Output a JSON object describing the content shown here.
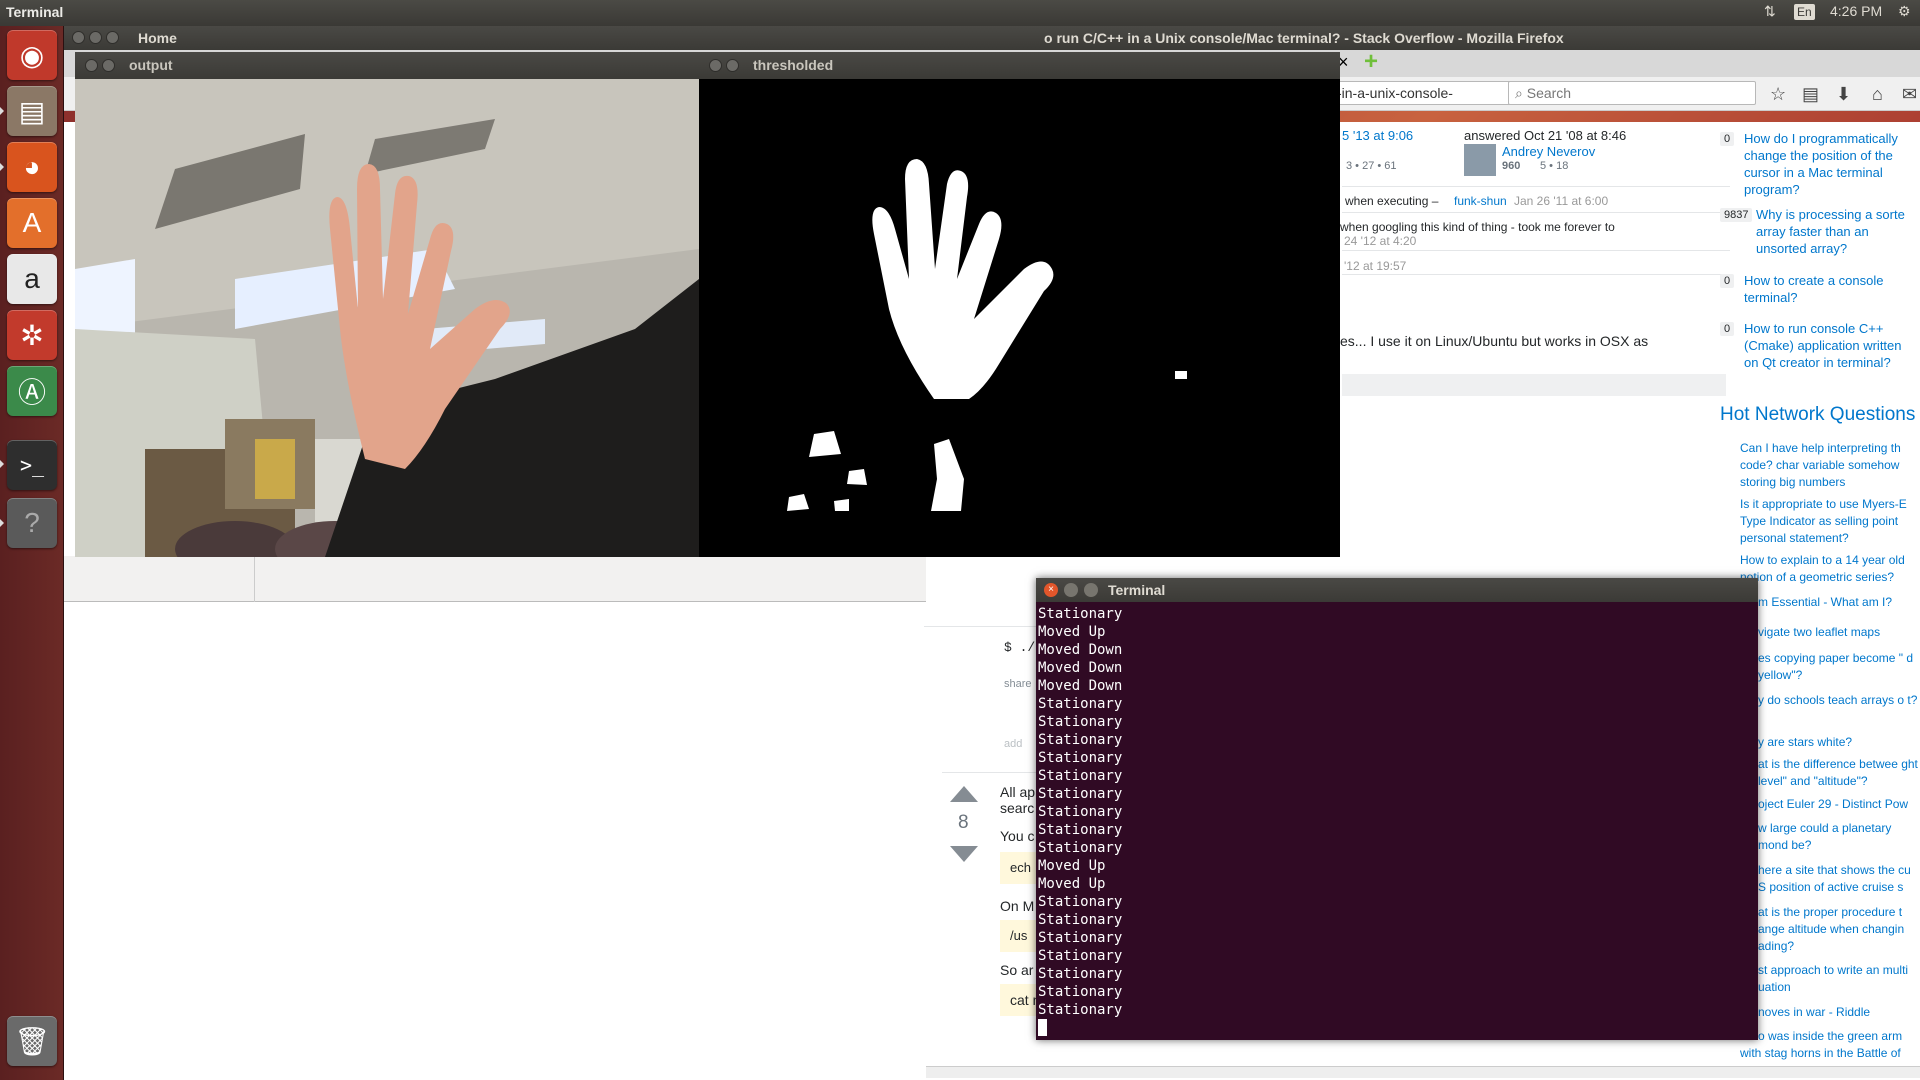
{
  "top_panel": {
    "title": "Terminal",
    "keyboard": "En",
    "time": "4:26 PM",
    "network_icon": "network-arrows-icon"
  },
  "launcher": {
    "items": [
      {
        "name": "dash-home",
        "icon": "ubuntu-logo-icon",
        "color": "#c0392b"
      },
      {
        "name": "files",
        "icon": "file-cabinet-icon",
        "color": "#7d6b5a"
      },
      {
        "name": "firefox",
        "icon": "firefox-icon",
        "color": "#d9541e"
      },
      {
        "name": "software-center",
        "icon": "shopping-bag-icon",
        "color": "#e36f2b"
      },
      {
        "name": "amazon",
        "icon": "amazon-icon",
        "color": "#e8e8e8"
      },
      {
        "name": "system-settings",
        "icon": "wrench-gear-icon",
        "color": "#c23a2c"
      },
      {
        "name": "software-updater",
        "icon": "updater-icon",
        "color": "#3b8a4a"
      },
      {
        "name": "terminal",
        "icon": "terminal-icon",
        "color": "#2e2e2e"
      },
      {
        "name": "help",
        "icon": "question-icon",
        "color": "#5a5a5a"
      },
      {
        "name": "trash",
        "icon": "trash-icon",
        "color": "#6a6a6a"
      }
    ]
  },
  "firefox": {
    "home_label": "Home",
    "window_title": "o run C/C++ in a Unix console/Mac terminal? - Stack Overflow - Mozilla Firefox",
    "url": "-in-a-unix-console-",
    "search_placeholder": "Search",
    "page": {
      "edit_time": "5 '13 at 9:06",
      "answered": "answered Oct 21 '08 at 8:46",
      "author": "Andrey Neverov",
      "author_rep": "960",
      "badges_left": "3 • 27 • 61",
      "badges_author": "5 • 18",
      "comment1": "when executing –",
      "comment1_user": "funk-shun",
      "comment1_time": "Jan 26 '11 at 6:00",
      "comment2": "when googling this kind of thing - took me forever to",
      "comment2_time": "24 '12 at 4:20",
      "comment3_time": "'12 at 19:57",
      "answer_text": "es... I use it on Linux/Ubuntu but works in OSX as",
      "prompt_frag": "$ ./",
      "share_frag": "share",
      "add_frag": "add",
      "vote_count": "8",
      "ans2_l1": "All ap",
      "ans2_l2": "searc",
      "ans2_l3": "You c",
      "ans2_code1": "ech",
      "ans2_l4": "On M",
      "ans2_code2": "/us",
      "ans2_l5": "So ar",
      "ans2_code3": "cat mytextfile.txt"
    },
    "sidebar": {
      "related": [
        {
          "count": "0",
          "title": "How do I programmatically change the position of the cursor in a Mac terminal program?"
        },
        {
          "count": "9837",
          "title": "Why is processing a sorte array faster than an unsorted array?"
        },
        {
          "count": "0",
          "title": "How to create a console terminal?"
        },
        {
          "count": "0",
          "title": "How to run console C++(Cmake) application written on Qt creator in terminal?"
        }
      ],
      "hot_title": "Hot Network Questions",
      "hot": [
        "Can I have help interpreting th code? char variable somehow storing big numbers",
        "Is it appropriate to use Myers-E Type Indicator as selling point personal statement?",
        "How to explain to a 14 year old notion of a geometric series?",
        "m Essential - What am I?",
        "vigate two leaflet maps",
        "es copying paper become \" d yellow\"?",
        "y do schools teach arrays o t?",
        "y are stars white?",
        "at is the difference betwee ght level\" and \"altitude\"?",
        "oject Euler 29 - Distinct Pow",
        "w large could a planetary mond be?",
        "here a site that shows the cu S position of active cruise s",
        "at is the proper procedure t ange altitude when changin ading?",
        "st approach to write an multi uation",
        "noves in war - Riddle",
        "Who was inside the green arm with stag horns in the Battle of"
      ]
    }
  },
  "output_window": {
    "title": "output"
  },
  "thresholded_window": {
    "title": "thresholded"
  },
  "terminal": {
    "title": "Terminal",
    "lines": [
      "Stationary",
      "Moved Up",
      "Moved Down",
      "Moved Down",
      "Moved Down",
      "Stationary",
      "Stationary",
      "Stationary",
      "Stationary",
      "Stationary",
      "Stationary",
      "Stationary",
      "Stationary",
      "Stationary",
      "Moved Up",
      "Moved Up",
      "Stationary",
      "Stationary",
      "Stationary",
      "Stationary",
      "Stationary",
      "Stationary",
      "Stationary"
    ]
  }
}
